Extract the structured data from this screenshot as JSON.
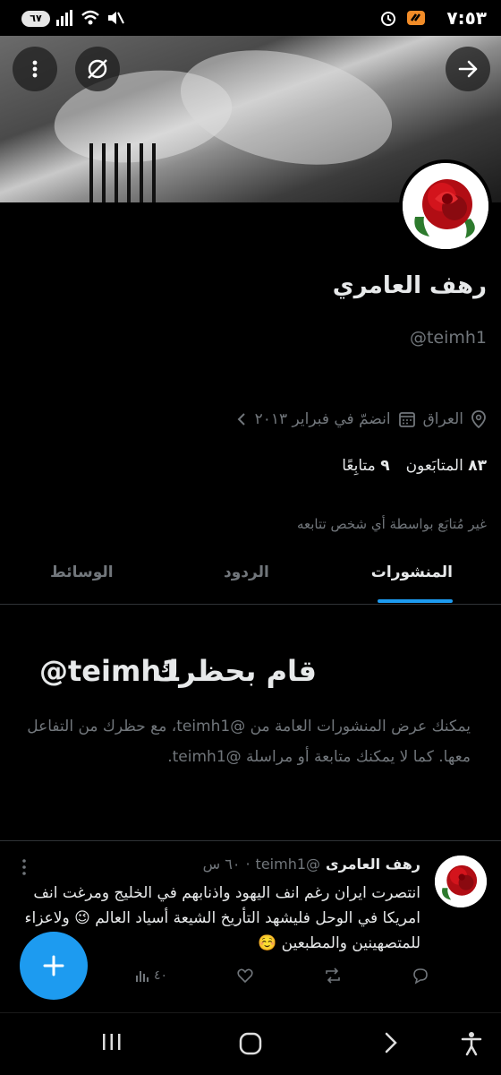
{
  "status_bar": {
    "time": "٧:٥٣",
    "battery": "٦٧"
  },
  "profile": {
    "name": "رهف العامري",
    "handle": "@teimh1",
    "location": "العراق",
    "joined": "انضمّ في فبراير ٢٠١٣",
    "followers_count": "٨٣",
    "followers_label": "المتابَعون",
    "following_count": "٩",
    "following_label": "متابِعًا",
    "not_followed_note": "غير مُتابَع بواسطة أي شخص تتابعه"
  },
  "tabs": [
    {
      "label": "المنشورات",
      "active": true
    },
    {
      "label": "الردود",
      "active": false
    },
    {
      "label": "الوسائط",
      "active": false
    }
  ],
  "blocked": {
    "title": "قام بحظرك",
    "title_handle": "@teimh1",
    "description": "يمكنك عرض المنشورات العامة من @teimh1، مع حظرك من التفاعل معها. كما لا يمكنك متابعة أو مراسلة @teimh1."
  },
  "tweet": {
    "author": "رهف العامرى",
    "handle": "@teimh1",
    "time": "٦٠ س",
    "text": "انتصرت ايران رغم انف اليهود واذنابهم في الخليج ومرغت انف امريكا في الوحل فليشهد التأريخ الشيعة أسياد العالم 😉 ولاعزاء للمتصهينين والمطبعين ☺️",
    "views": "٤٠"
  },
  "colors": {
    "accent": "#1d9bf0",
    "background": "#000000",
    "muted": "#71767b"
  }
}
